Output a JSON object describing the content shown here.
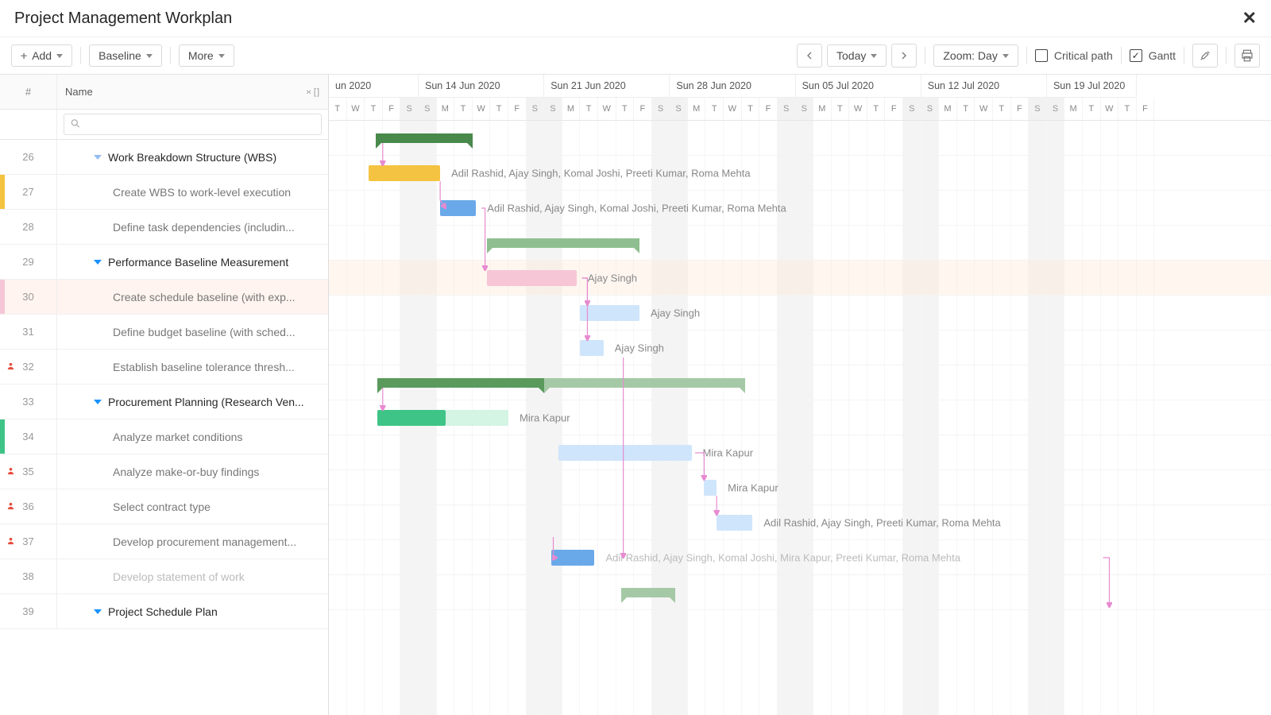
{
  "header": {
    "title": "Project Management Workplan"
  },
  "toolbar": {
    "add": "Add",
    "baseline": "Baseline",
    "more": "More",
    "today": "Today",
    "zoom": "Zoom: Day",
    "critical_path": "Critical path",
    "gantt": "Gantt"
  },
  "grid": {
    "num_header": "#",
    "name_header": "Name"
  },
  "timeline": {
    "weeks": [
      {
        "label": "un 2020",
        "days": 5,
        "start_offset": 0
      },
      {
        "label": "Sun 14 Jun 2020",
        "days": 7
      },
      {
        "label": "Sun 21 Jun 2020",
        "days": 7
      },
      {
        "label": "Sun 28 Jun 2020",
        "days": 7
      },
      {
        "label": "Sun 05 Jul 2020",
        "days": 7
      },
      {
        "label": "Sun 12 Jul 2020",
        "days": 7
      },
      {
        "label": "Sun 19 Jul 2020",
        "days": 5
      }
    ],
    "day_labels": [
      "T",
      "W",
      "T",
      "F",
      "S",
      "S",
      "M",
      "T",
      "W",
      "T",
      "F",
      "S",
      "S",
      "M",
      "T",
      "W",
      "T",
      "F",
      "S",
      "S",
      "M",
      "T",
      "W",
      "T",
      "F",
      "S",
      "S",
      "M",
      "T",
      "W",
      "T",
      "F",
      "S",
      "S",
      "M",
      "T",
      "W",
      "T",
      "F",
      "S",
      "S",
      "M",
      "T",
      "W",
      "T",
      "F"
    ],
    "weekend_indices": [
      4,
      5,
      11,
      12,
      18,
      19,
      25,
      26,
      32,
      33,
      39,
      40
    ]
  },
  "rows": [
    {
      "num": 26,
      "type": "group",
      "name": "Work Breakdown Structure (WBS)",
      "chevron": "muted",
      "bar": {
        "kind": "summary",
        "start": 2.6,
        "span": 5.4,
        "color": "#49894b"
      }
    },
    {
      "num": 27,
      "type": "task",
      "name": "Create WBS to work-level execution",
      "marker": "#f5c342",
      "bar": {
        "kind": "task",
        "start": 2.2,
        "span": 4,
        "color": "#f5c342",
        "label": "Adil Rashid, Ajay Singh, Komal Joshi, Preeti Kumar, Roma Mehta"
      }
    },
    {
      "num": 28,
      "type": "task",
      "name": "Define task dependencies (includin...",
      "bar": {
        "kind": "task",
        "start": 6.2,
        "span": 2,
        "color": "#6aa9e9",
        "label": "Adil Rashid, Ajay Singh, Komal Joshi, Preeti Kumar, Roma Mehta"
      }
    },
    {
      "num": 29,
      "type": "group",
      "name": "Performance Baseline Measurement",
      "chevron": "normal",
      "bar": {
        "kind": "summary",
        "start": 8.8,
        "span": 8.5,
        "color": "#8fbf91"
      }
    },
    {
      "num": 30,
      "type": "task",
      "name": "Create schedule baseline (with exp...",
      "marker": "#f6c6d6",
      "hl": "pink",
      "bar": {
        "kind": "task",
        "start": 8.8,
        "span": 5,
        "color": "#f6c6d6",
        "label": "Ajay Singh"
      }
    },
    {
      "num": 31,
      "type": "task",
      "name": "Define budget baseline (with sched...",
      "bar": {
        "kind": "task",
        "start": 14,
        "span": 3.3,
        "color": "#cfe5fb",
        "label": "Ajay Singh"
      }
    },
    {
      "num": 32,
      "type": "task",
      "name": "Establish baseline tolerance thresh...",
      "person": true,
      "bar": {
        "kind": "task",
        "start": 14,
        "span": 1.3,
        "color": "#cfe5fb",
        "label": "Ajay Singh"
      }
    },
    {
      "num": 33,
      "type": "group",
      "name": "Procurement Planning (Research Ven...",
      "chevron": "normal",
      "bar": {
        "kind": "summary2",
        "start": 2.7,
        "span": 20.5,
        "color": "#5a9a5c",
        "split": 9.3,
        "color2": "#a5c9a6"
      }
    },
    {
      "num": 34,
      "type": "task",
      "name": "Analyze market conditions",
      "marker": "#3fc487",
      "bar": {
        "kind": "task2",
        "start": 2.7,
        "span": 7.3,
        "color": "#3fc487",
        "split": 3.8,
        "color2": "#d4f4e4",
        "label": "Mira Kapur"
      }
    },
    {
      "num": 35,
      "type": "task",
      "name": "Analyze make-or-buy findings",
      "person": true,
      "bar": {
        "kind": "task",
        "start": 12.8,
        "span": 7.4,
        "color": "#cfe5fb",
        "label": "Mira Kapur"
      }
    },
    {
      "num": 36,
      "type": "task",
      "name": "Select contract type",
      "person": true,
      "bar": {
        "kind": "task",
        "start": 20.9,
        "span": 0.7,
        "color": "#cfe5fb",
        "label": "Mira Kapur"
      }
    },
    {
      "num": 37,
      "type": "task",
      "name": "Develop procurement management...",
      "person": true,
      "bar": {
        "kind": "task",
        "start": 21.6,
        "span": 2.0,
        "color": "#cfe5fb",
        "label": "Adil Rashid, Ajay Singh, Preeti Kumar, Roma Mehta"
      }
    },
    {
      "num": 38,
      "type": "task",
      "name": "Develop statement of work",
      "muted": true,
      "bar": {
        "kind": "task",
        "start": 12.4,
        "span": 2.4,
        "color": "#6aa9e9",
        "label": "Adil Rashid, Ajay Singh, Komal Joshi, Mira Kapur, Preeti Kumar, Roma Mehta"
      }
    },
    {
      "num": 39,
      "type": "group",
      "name": "Project Schedule Plan",
      "chevron": "normal",
      "bar": {
        "kind": "summary",
        "start": 16.3,
        "span": 3,
        "color": "#a5c9a6"
      }
    }
  ]
}
